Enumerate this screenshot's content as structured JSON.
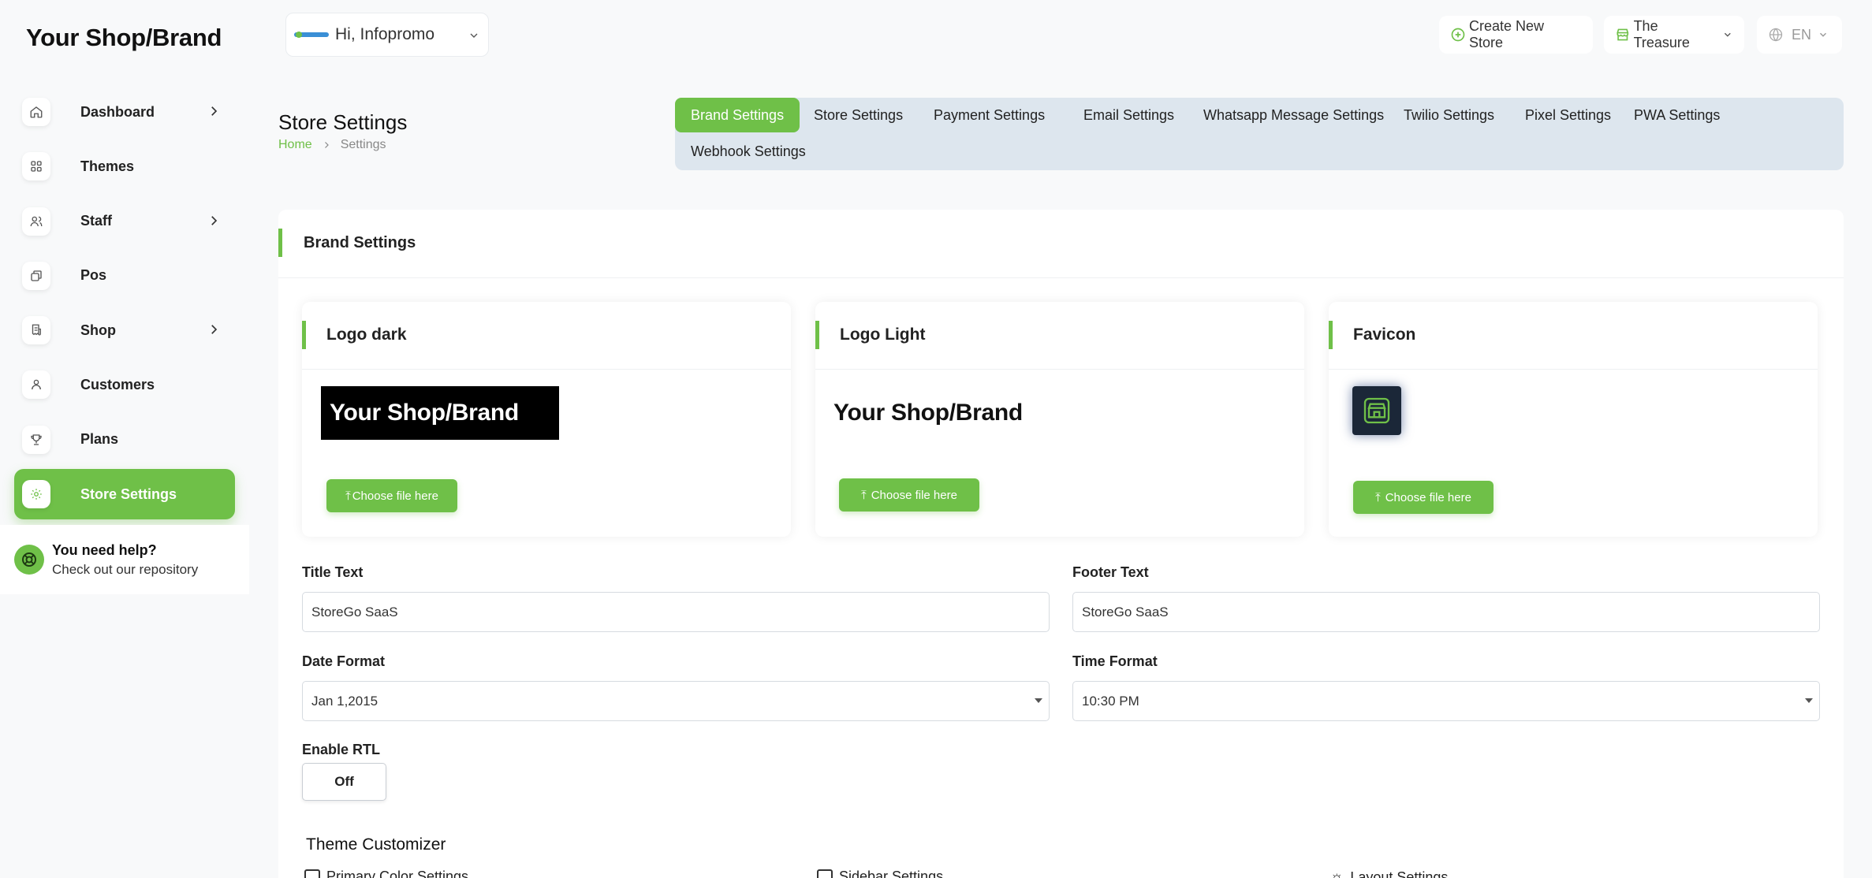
{
  "brand": "Your Shop/Brand",
  "header": {
    "greeting": "Hi, Infopromo",
    "create_store": "Create New Store",
    "store_name": "The Treasure",
    "language": "EN"
  },
  "sidebar": {
    "items": [
      {
        "label": "Dashboard",
        "icon": "home-icon",
        "has_children": true
      },
      {
        "label": "Themes",
        "icon": "grid-icon",
        "has_children": false
      },
      {
        "label": "Staff",
        "icon": "users-icon",
        "has_children": true
      },
      {
        "label": "Pos",
        "icon": "layers-icon",
        "has_children": false
      },
      {
        "label": "Shop",
        "icon": "receipt-icon",
        "has_children": true
      },
      {
        "label": "Customers",
        "icon": "user-icon",
        "has_children": false
      },
      {
        "label": "Plans",
        "icon": "trophy-icon",
        "has_children": false
      },
      {
        "label": "Store Settings",
        "icon": "gear-icon",
        "has_children": false,
        "active": true
      }
    ],
    "help_title": "You need help?",
    "help_subtitle": "Check out our repository"
  },
  "page": {
    "title": "Store Settings",
    "breadcrumb_home": "Home",
    "breadcrumb_current": "Settings"
  },
  "tabs": [
    "Brand Settings",
    "Store Settings",
    "Payment Settings",
    "Email Settings",
    "Whatsapp Message Settings",
    "Twilio Settings",
    "Pixel Settings",
    "PWA Settings",
    "Webhook Settings"
  ],
  "brand_settings": {
    "heading": "Brand Settings",
    "logo_dark_title": "Logo dark",
    "logo_light_title": "Logo Light",
    "favicon_title": "Favicon",
    "logo_text": "Your Shop/Brand",
    "choose_label": "Choose file here",
    "title_text_label": "Title Text",
    "title_text_value": "StoreGo SaaS",
    "footer_text_label": "Footer Text",
    "footer_text_value": "StoreGo SaaS",
    "date_format_label": "Date Format",
    "date_format_value": "Jan 1,2015",
    "time_format_label": "Time Format",
    "time_format_value": "10:30 PM",
    "rtl_label": "Enable RTL",
    "rtl_value": "Off",
    "theme_customizer": "Theme Customizer",
    "customizer_items": [
      "Primary Color Settings",
      "Sidebar Settings",
      "Layout Settings"
    ]
  },
  "colors": {
    "accent": "#6fc048",
    "tabs_bg": "#dde6ee",
    "page_bg": "#f8f9fa"
  }
}
